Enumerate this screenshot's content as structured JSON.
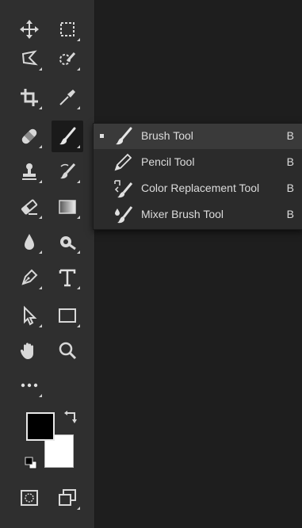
{
  "toolbar": {
    "tools": [
      {
        "name": "Move Tool",
        "icon": "move-icon"
      },
      {
        "name": "Rectangular Marquee Tool",
        "icon": "marquee-icon"
      },
      {
        "name": "Lasso Tool",
        "icon": "lasso-icon"
      },
      {
        "name": "Quick Selection Tool",
        "icon": "quick-selection-icon"
      },
      {
        "name": "Crop Tool",
        "icon": "crop-icon"
      },
      {
        "name": "Eyedropper Tool",
        "icon": "eyedropper-icon"
      },
      {
        "name": "Spot Healing Brush Tool",
        "icon": "healing-bandage-icon"
      },
      {
        "name": "Brush Tool",
        "icon": "brush-icon",
        "selected": true
      },
      {
        "name": "Clone Stamp Tool",
        "icon": "stamp-icon"
      },
      {
        "name": "History Brush Tool",
        "icon": "history-brush-icon"
      },
      {
        "name": "Eraser Tool",
        "icon": "eraser-icon"
      },
      {
        "name": "Gradient Tool",
        "icon": "gradient-icon"
      },
      {
        "name": "Blur Tool",
        "icon": "blur-drop-icon"
      },
      {
        "name": "Dodge Tool",
        "icon": "dodge-icon"
      },
      {
        "name": "Pen Tool",
        "icon": "pen-icon"
      },
      {
        "name": "Type Tool",
        "icon": "type-icon",
        "glyph": "T"
      },
      {
        "name": "Path Selection Tool",
        "icon": "path-selection-icon"
      },
      {
        "name": "Rectangle Tool",
        "icon": "rectangle-icon"
      },
      {
        "name": "Hand Tool",
        "icon": "hand-icon"
      },
      {
        "name": "Zoom Tool",
        "icon": "zoom-icon"
      },
      {
        "name": "Edit Toolbar",
        "icon": "more-icon",
        "glyph": "•••"
      }
    ],
    "colors": {
      "foreground": "#000000",
      "background": "#ffffff"
    }
  },
  "flyout": {
    "items": [
      {
        "label": "Brush Tool",
        "shortcut": "B",
        "icon": "brush-icon",
        "active": true
      },
      {
        "label": "Pencil Tool",
        "shortcut": "B",
        "icon": "pencil-icon"
      },
      {
        "label": "Color Replacement Tool",
        "shortcut": "B",
        "icon": "color-replacement-icon"
      },
      {
        "label": "Mixer Brush Tool",
        "shortcut": "B",
        "icon": "mixer-brush-icon"
      }
    ]
  },
  "theme": {
    "panel": "#2f2f2f",
    "canvas": "#1e1e1e",
    "menu": "#2b2b2b",
    "highlight": "#3a3a3a"
  }
}
